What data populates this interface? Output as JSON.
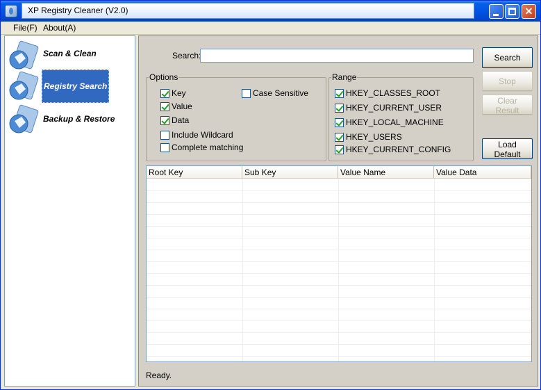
{
  "window": {
    "title": "XP Registry Cleaner (V2.0)"
  },
  "menu": {
    "file": "File(F)",
    "about": "About(A)"
  },
  "sidebar": {
    "items": [
      {
        "label": "Scan & Clean"
      },
      {
        "label": "Registry Search"
      },
      {
        "label": "Backup & Restore"
      }
    ]
  },
  "search": {
    "label": "Search:",
    "value": "",
    "placeholder": ""
  },
  "buttons": {
    "search": "Search",
    "stop": "Stop",
    "clear": "Clear Result",
    "load_default": "Load Default"
  },
  "options": {
    "title": "Options",
    "key": {
      "label": "Key",
      "checked": true
    },
    "value": {
      "label": "Value",
      "checked": true
    },
    "data": {
      "label": "Data",
      "checked": true
    },
    "wildcard": {
      "label": "Include Wildcard",
      "checked": false
    },
    "complete": {
      "label": "Complete matching",
      "checked": false
    },
    "case": {
      "label": "Case Sensitive",
      "checked": false
    }
  },
  "range": {
    "title": "Range",
    "items": [
      {
        "label": "HKEY_CLASSES_ROOT",
        "checked": true
      },
      {
        "label": "HKEY_CURRENT_USER",
        "checked": true
      },
      {
        "label": "HKEY_LOCAL_MACHINE",
        "checked": true
      },
      {
        "label": "HKEY_USERS",
        "checked": true
      },
      {
        "label": "HKEY_CURRENT_CONFIG",
        "checked": true
      }
    ]
  },
  "table": {
    "columns": [
      "Root Key",
      "Sub Key",
      "Value Name",
      "Value Data"
    ],
    "rows": []
  },
  "status": "Ready.",
  "icons": {
    "app": "registry-cleaner-app-icon",
    "scan": "scan-clean-icon",
    "search": "registry-search-icon",
    "backup": "backup-restore-icon"
  }
}
